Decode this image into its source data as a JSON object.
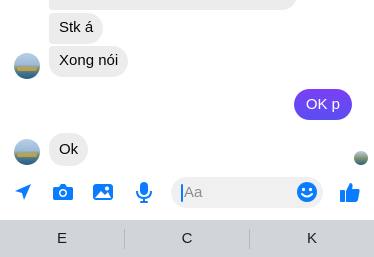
{
  "messages": {
    "cut_top_text": "",
    "incoming_1": "Stk á",
    "incoming_2": "Xong nói",
    "outgoing_1": "OK p",
    "incoming_3": "Ok"
  },
  "composer": {
    "placeholder": "Aa",
    "value": ""
  },
  "keyboard": {
    "suggestions": [
      "E",
      "C",
      "K"
    ]
  },
  "colors": {
    "accent": "#0a7cff",
    "outgoing_bubble": "#6d3cf3",
    "incoming_bubble": "#ececec",
    "suggestion_bar": "#d1d4d9"
  },
  "icons": [
    "location-arrow-icon",
    "camera-icon",
    "photo-icon",
    "microphone-icon",
    "emoji-icon",
    "thumbs-up-icon"
  ]
}
